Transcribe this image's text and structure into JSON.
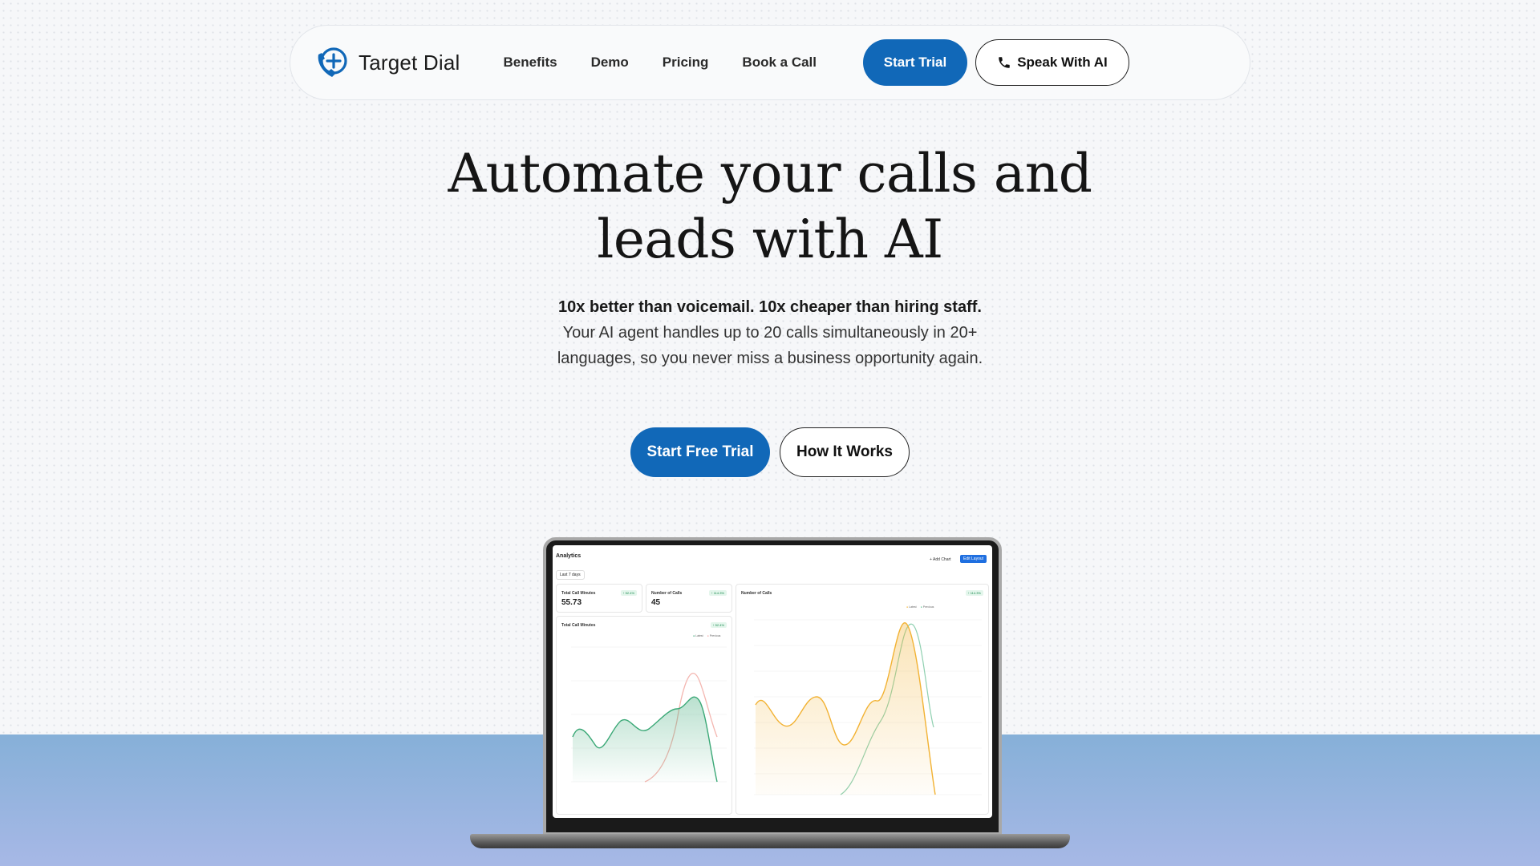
{
  "nav": {
    "brand": "Target Dial",
    "links": [
      "Benefits",
      "Demo",
      "Pricing",
      "Book a Call"
    ],
    "start_trial": "Start Trial",
    "speak_ai": "Speak With AI"
  },
  "hero": {
    "title_line1": "Automate your calls and",
    "title_line2": "leads with AI",
    "sub_strong": "10x better than voicemail. 10x cheaper than hiring staff.",
    "sub_text": "Your AI agent handles up to 20 calls simultaneously in 20+ languages, so you never miss a business opportunity again.",
    "cta_primary": "Start Free Trial",
    "cta_secondary": "How It Works"
  },
  "dashboard": {
    "title": "Analytics",
    "period": "Last 7 days",
    "add_chart": "+ Add Chart",
    "edit_layout": "Edit Layout",
    "cards": [
      {
        "label": "Total Call Minutes",
        "value": "55.73",
        "badge": "↑ 52.4%"
      },
      {
        "label": "Number of Calls",
        "value": "45",
        "badge": "↑ 114.3%"
      }
    ],
    "minutes_chart": {
      "label": "Total Call Minutes",
      "badge": "↑ 52.4%",
      "legend": [
        "Latest",
        "Previous"
      ]
    },
    "calls_chart": {
      "label": "Number of Calls",
      "badge": "↑ 114.3%",
      "legend": [
        "Latest",
        "Previous"
      ]
    }
  },
  "colors": {
    "primary": "#1168b8",
    "series_green": "#3aa876",
    "series_orange": "#f2b233",
    "series_pink": "#f4b6b0"
  }
}
